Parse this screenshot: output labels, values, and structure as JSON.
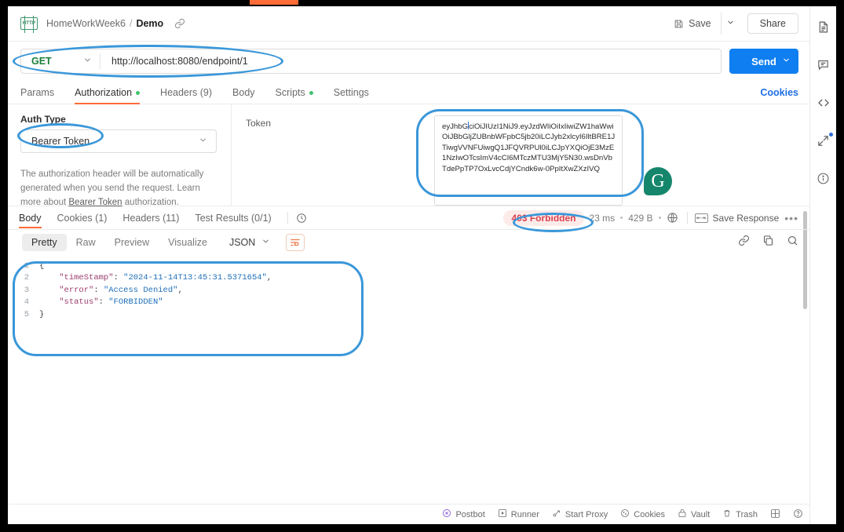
{
  "header": {
    "breadcrumb_collection": "HomeWorkWeek6",
    "breadcrumb_sep": "/",
    "breadcrumb_request": "Demo",
    "http_badge": "HTTP",
    "save_label": "Save",
    "share_label": "Share"
  },
  "urlbar": {
    "method": "GET",
    "url": "http://localhost:8080/endpoint/1",
    "send_label": "Send"
  },
  "request_tabs": {
    "items": [
      {
        "label": "Params",
        "dot": false,
        "active": false
      },
      {
        "label": "Authorization",
        "dot": true,
        "active": true
      },
      {
        "label": "Headers (9)",
        "dot": false,
        "active": false
      },
      {
        "label": "Body",
        "dot": false,
        "active": false
      },
      {
        "label": "Scripts",
        "dot": true,
        "active": false
      },
      {
        "label": "Settings",
        "dot": false,
        "active": false
      }
    ],
    "cookies_link": "Cookies"
  },
  "auth": {
    "type_label": "Auth Type",
    "type_value": "Bearer Token",
    "description_1": "The authorization header will be automatically",
    "description_2": "generated when you send the request. Learn more",
    "description_3a": "about ",
    "description_3b": "Bearer Token",
    "description_3c": " authorization.",
    "token_label": "Token",
    "token_value_line1_a": "eyJhbG",
    "token_value_line1_b": "ciOiJIUzI1NiJ9.eyJzdWIiOiIxIiwiZW1ha",
    "token_value_line2": "WwiOiJBbGljZUBnbWFpbC5jb20iLCJyb2xlcyI",
    "token_value_line3": "6IltBRE1JTiwgVVNFUiwgQ1JFQVRPUl0iLCJp",
    "token_value_line4": "YXQiOjE3MzE1NzIwOTcsImV4cCI6MTczMTU",
    "token_value_line5": "3MjY5N30.wsDnVbTdePpTP7OxLvcCdjYCnd",
    "token_value_line6": "k6w-0PpItXwZXzIVQ"
  },
  "response": {
    "tabs": [
      {
        "label": "Body",
        "active": true
      },
      {
        "label": "Cookies (1)",
        "active": false
      },
      {
        "label": "Headers (11)",
        "active": false
      },
      {
        "label": "Test Results (0/1)",
        "active": false
      }
    ],
    "status": "403 Forbidden",
    "time": "23 ms",
    "size": "429 B",
    "save_response": "Save Response",
    "ellipsis": "•••",
    "viewer_tabs": [
      {
        "label": "Pretty",
        "active": true
      },
      {
        "label": "Raw",
        "active": false
      },
      {
        "label": "Preview",
        "active": false
      },
      {
        "label": "Visualize",
        "active": false
      }
    ],
    "format": "JSON",
    "body_lines": [
      {
        "num": "1",
        "text": "{"
      },
      {
        "num": "2",
        "text": "    \"timeStamp\": \"2024-11-14T13:45:31.5371654\","
      },
      {
        "num": "3",
        "text": "    \"error\": \"Access Denied\","
      },
      {
        "num": "4",
        "text": "    \"status\": \"FORBIDDEN\""
      },
      {
        "num": "5",
        "text": "}"
      }
    ],
    "body_code": {
      "l1": "{",
      "l2_key": "\"timeStamp\"",
      "l2_val": "\"2024-11-14T13:45:31.5371654\"",
      "l3_key": "\"error\"",
      "l3_val": "\"Access Denied\"",
      "l4_key": "\"status\"",
      "l4_val": "\"FORBIDDEN\"",
      "l5": "}"
    }
  },
  "bottom_bar": {
    "items": [
      {
        "label": "Postbot",
        "icon": "postbot-icon"
      },
      {
        "label": "Runner",
        "icon": "runner-icon"
      },
      {
        "label": "Start Proxy",
        "icon": "proxy-icon"
      },
      {
        "label": "Cookies",
        "icon": "cookies-icon"
      },
      {
        "label": "Vault",
        "icon": "vault-icon"
      },
      {
        "label": "Trash",
        "icon": "trash-icon"
      }
    ]
  },
  "annotation_badge": {
    "letter": "G",
    "color": "#15866b"
  },
  "colors": {
    "accent_orange": "#ff6c37",
    "send_blue": "#0f7ef0",
    "annotation_blue": "#3a97d9",
    "status_red": "#d9414e",
    "method_green": "#1a7f37"
  }
}
